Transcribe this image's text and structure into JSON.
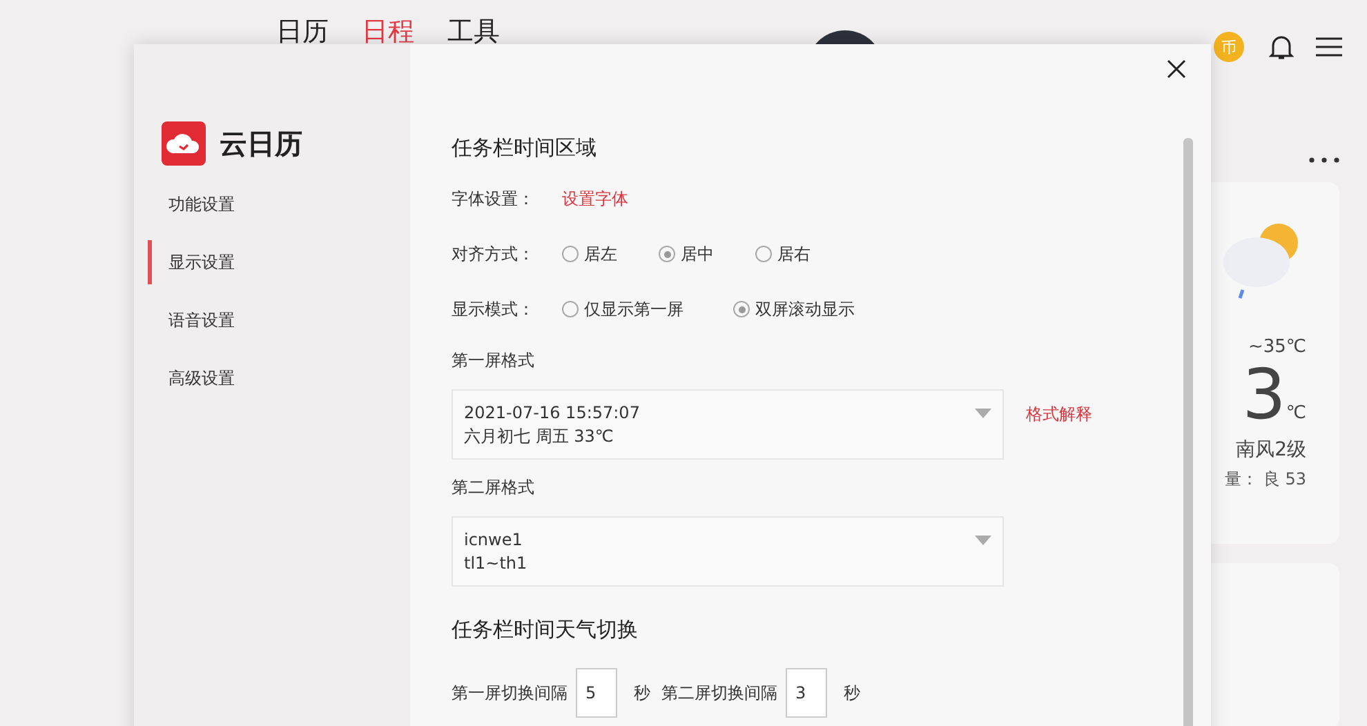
{
  "nav": {
    "tabs": [
      {
        "label": "日历",
        "selected": false
      },
      {
        "label": "日程",
        "selected": true
      },
      {
        "label": "工具",
        "selected": false
      }
    ],
    "coin": "币"
  },
  "weather": {
    "temp_range": "~35℃",
    "temp": "3",
    "unit": "℃",
    "wind": "南风2级",
    "air": "量： 良 53"
  },
  "dialog": {
    "app_name": "云日历",
    "menu": [
      {
        "label": "功能设置",
        "selected": false
      },
      {
        "label": "显示设置",
        "selected": true
      },
      {
        "label": "语音设置",
        "selected": false
      },
      {
        "label": "高级设置",
        "selected": false
      }
    ],
    "section_1": {
      "title": "任务栏时间区域",
      "font": {
        "label": "字体设置：",
        "link": "设置字体"
      },
      "align": {
        "label": "对齐方式：",
        "options": [
          {
            "label": "居左",
            "selected": false
          },
          {
            "label": "居中",
            "selected": true
          },
          {
            "label": "居右",
            "selected": false
          }
        ]
      },
      "mode": {
        "label": "显示模式：",
        "options": [
          {
            "label": "仅显示第一屏",
            "selected": false
          },
          {
            "label": "双屏滚动显示",
            "selected": true
          }
        ]
      },
      "first": {
        "label": "第一屏格式",
        "lines": [
          "2021-07-16 15:57:07",
          "六月初七 周五 33℃"
        ],
        "link": "格式解释"
      },
      "second": {
        "label": "第二屏格式",
        "lines": [
          "icnwe1",
          "tl1~th1"
        ]
      }
    },
    "section_2": {
      "title": "任务栏时间天气切换",
      "intervals": [
        {
          "label": "第一屏切换间隔",
          "value": "5",
          "unit": "秒"
        },
        {
          "label": "第二屏切换间隔",
          "value": "3",
          "unit": "秒"
        }
      ]
    }
  }
}
